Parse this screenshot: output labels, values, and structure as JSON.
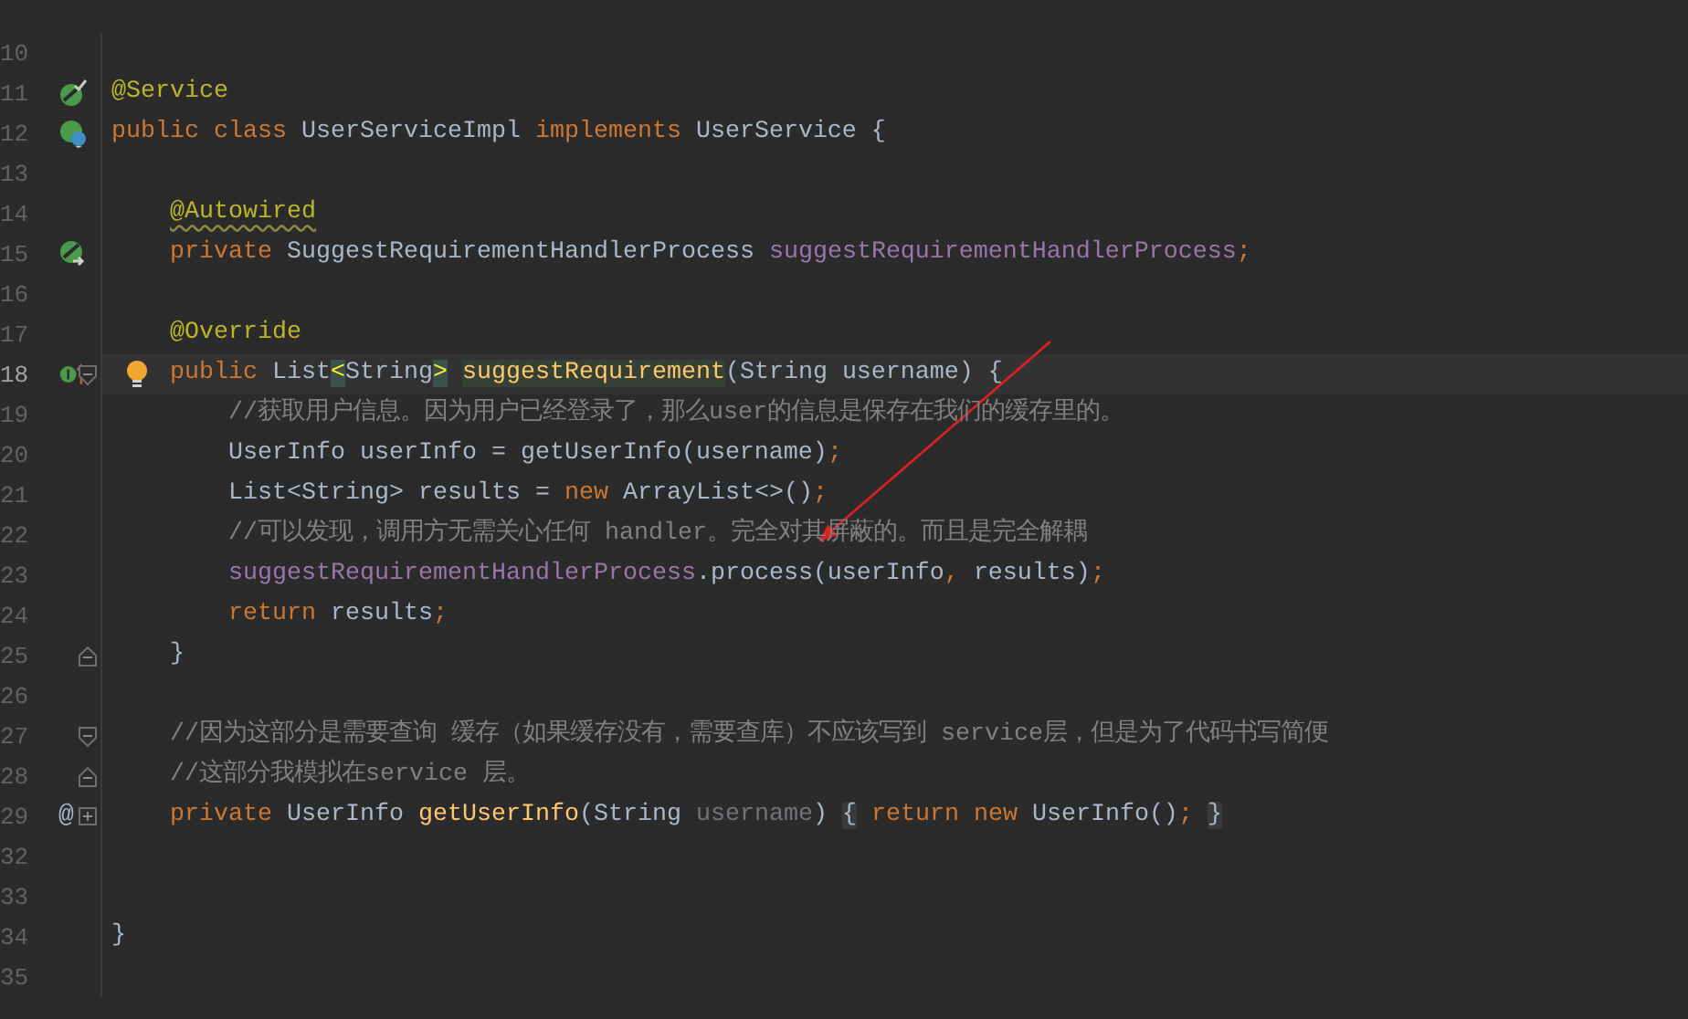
{
  "editor": {
    "lines": [
      {
        "number": "10",
        "current": false
      },
      {
        "number": "11",
        "current": false,
        "gutter": {
          "kind": "bean"
        },
        "tokens": [
          {
            "text": "@Service",
            "kind": "annotation"
          }
        ]
      },
      {
        "number": "12",
        "current": false,
        "gutter": {
          "kind": "bean-impl"
        },
        "tokens": [
          {
            "text": "public class ",
            "kind": "keyword"
          },
          {
            "text": "UserServiceImpl ",
            "kind": "type"
          },
          {
            "text": "implements ",
            "kind": "keyword"
          },
          {
            "text": "UserService {",
            "kind": "type"
          }
        ],
        "children": [
          {
            "number": "13",
            "current": false
          },
          {
            "number": "14",
            "current": false,
            "tokens": [
              {
                "text": "@Autowired",
                "kind": "annotation-warn"
              }
            ]
          },
          {
            "number": "15",
            "current": false,
            "gutter": {
              "kind": "autowired"
            },
            "tokens": [
              {
                "text": "private ",
                "kind": "keyword"
              },
              {
                "text": "SuggestRequirementHandlerProcess ",
                "kind": "type"
              },
              {
                "text": "suggestRequirementHandlerProcess",
                "kind": "field"
              },
              {
                "text": ";",
                "kind": "keyword"
              }
            ]
          },
          {
            "number": "16",
            "current": false
          },
          {
            "number": "17",
            "current": false,
            "tokens": [
              {
                "text": "@Override",
                "kind": "annotation"
              }
            ]
          },
          {
            "number": "18",
            "current": true,
            "gutter": {
              "kind": "override"
            },
            "bulb": true,
            "fold": {
              "kind": "start"
            },
            "tokens": [
              {
                "text": "public ",
                "kind": "keyword"
              },
              {
                "text": "List",
                "kind": "type"
              },
              {
                "text": "<",
                "kind": "brace-match"
              },
              {
                "text": "String",
                "kind": "type"
              },
              {
                "text": ">",
                "kind": "brace-match"
              },
              {
                "text": "suggestRequirement",
                "kind": "method-highlight"
              },
              {
                "text": "(String username) {",
                "kind": "type"
              }
            ],
            "children": [
              {
                "number": "19",
                "current": false,
                "tokens": [
                  {
                    "text": "//获取用户信息。因为用户已经登录了，那么user的信息是保存在我们的缓存里的。",
                    "kind": "comment"
                  }
                ]
              },
              {
                "number": "20",
                "current": false,
                "tokens": [
                  {
                    "text": "UserInfo userInfo = getUserInfo(username)",
                    "kind": "type"
                  },
                  {
                    "text": ";",
                    "kind": "keyword"
                  }
                ]
              },
              {
                "number": "21",
                "current": false,
                "tokens": [
                  {
                    "text": "List<String> results = ",
                    "kind": "type"
                  },
                  {
                    "text": "new ",
                    "kind": "keyword"
                  },
                  {
                    "text": "ArrayList<>()",
                    "kind": "type"
                  },
                  {
                    "text": ";",
                    "kind": "keyword"
                  }
                ]
              },
              {
                "number": "22",
                "current": false,
                "tokens": [
                  {
                    "text": "//可以发现，调用方无需关心任何 handler。完全对其屏蔽的。而且是完全解耦",
                    "kind": "comment"
                  }
                ]
              },
              {
                "number": "23",
                "current": false,
                "tokens": [
                  {
                    "text": "suggestRequirementHandlerProcess",
                    "kind": "field"
                  },
                  {
                    "text": ".process(userInfo",
                    "kind": "type"
                  },
                  {
                    "text": ", ",
                    "kind": "keyword"
                  },
                  {
                    "text": "results)",
                    "kind": "type"
                  },
                  {
                    "text": ";",
                    "kind": "keyword"
                  }
                ]
              },
              {
                "number": "24",
                "current": false,
                "tokens": [
                  {
                    "text": "return ",
                    "kind": "keyword"
                  },
                  {
                    "text": "results",
                    "kind": "type"
                  },
                  {
                    "text": ";",
                    "kind": "keyword"
                  }
                ]
              }
            ]
          },
          {
            "number": "25",
            "current": false,
            "fold": {
              "kind": "end"
            },
            "tokens": [
              {
                "text": "}",
                "kind": "type"
              }
            ]
          },
          {
            "number": "26",
            "current": false
          },
          {
            "number": "27",
            "current": false,
            "fold": {
              "kind": "start"
            },
            "tokens": [
              {
                "text": "//因为这部分是需要查询 缓存（如果缓存没有，需要查库）不应该写到 service层，但是为了代码书写简便",
                "kind": "comment"
              }
            ]
          },
          {
            "number": "28",
            "current": false,
            "fold": {
              "kind": "end"
            },
            "tokens": [
              {
                "text": "//这部分我模拟在service 层。",
                "kind": "comment"
              }
            ]
          },
          {
            "number": "29",
            "current": false,
            "gutter_text": "@",
            "fold": {
              "kind": "plus"
            },
            "tokens": [
              {
                "text": "private ",
                "kind": "keyword"
              },
              {
                "text": "UserInfo ",
                "kind": "type"
              },
              {
                "text": "getUserInfo",
                "kind": "method"
              },
              {
                "text": "(String ",
                "kind": "type"
              },
              {
                "text": "username",
                "kind": "param-unused"
              },
              {
                "text": ") ",
                "kind": "type"
              },
              {
                "text": "{",
                "kind": "fold-brace"
              },
              {
                "text": " return new ",
                "kind": "keyword"
              },
              {
                "text": "UserInfo()",
                "kind": "type"
              },
              {
                "text": "; ",
                "kind": "keyword"
              },
              {
                "text": "}",
                "kind": "fold-brace"
              }
            ]
          },
          {
            "number": "32",
            "current": false
          },
          {
            "number": "33",
            "current": false
          }
        ]
      },
      {
        "number": "34",
        "current": false,
        "tokens": [
          {
            "text": "}",
            "kind": "type"
          }
        ]
      },
      {
        "number": "35",
        "current": false
      }
    ]
  }
}
